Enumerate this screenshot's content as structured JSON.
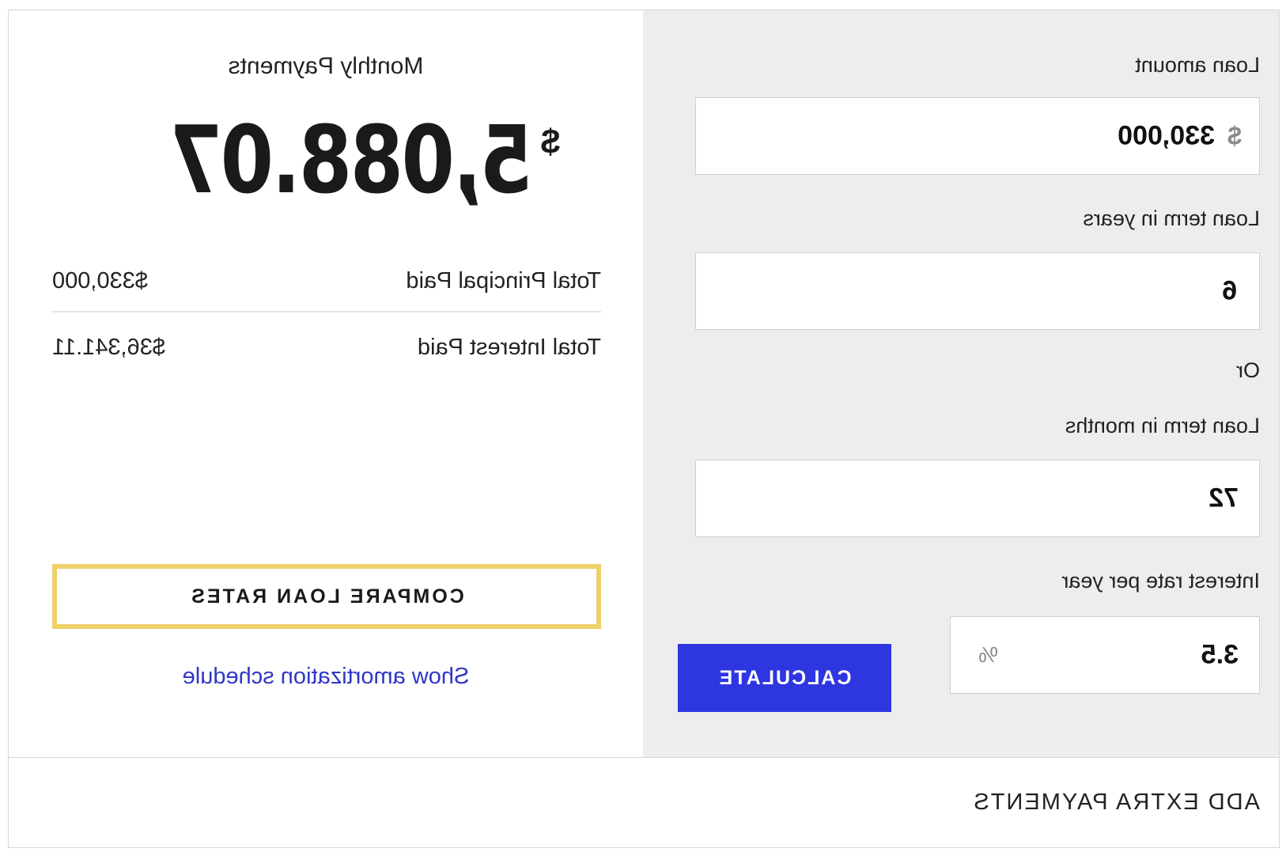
{
  "form": {
    "loan_amount": {
      "label": "Loan amount",
      "currency_symbol": "$",
      "value": "330,000"
    },
    "loan_term_years": {
      "label": "Loan term in years",
      "value": "6"
    },
    "or_label": "Or",
    "loan_term_months": {
      "label": "Loan term in months",
      "value": "72"
    },
    "interest_rate": {
      "label": "Interest rate per year",
      "value": "3.5",
      "unit": "%"
    },
    "calculate_label": "CALCULATE"
  },
  "results": {
    "title": "Monthly Payments",
    "currency_symbol": "$",
    "monthly_payment": "5,088.07",
    "total_principal": {
      "label": "Total Principal Paid",
      "value": "$330,000"
    },
    "total_interest": {
      "label": "Total Interest Paid",
      "value": "$36,341.11"
    },
    "compare_label": "COMPARE LOAN RATES",
    "amortization_link": "Show amortization schedule"
  },
  "footer": {
    "extra_payments_label": "ADD EXTRA PAYMENTS"
  },
  "colors": {
    "panel_bg": "#ededed",
    "calculate_bg": "#2e36e0",
    "compare_border": "#efd16a",
    "link": "#2f36c8"
  }
}
